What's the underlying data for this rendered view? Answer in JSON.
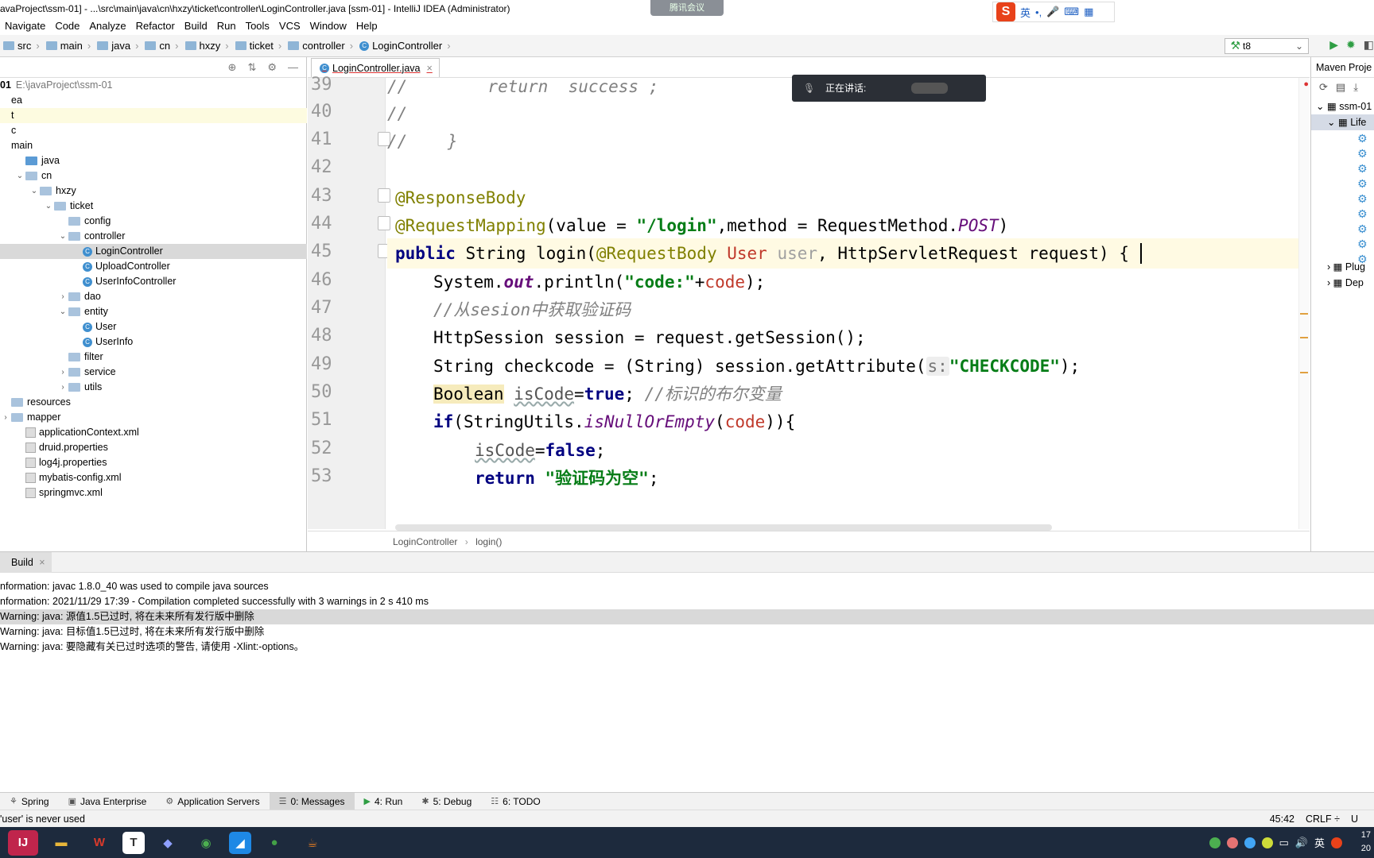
{
  "window": {
    "title": "avaProject\\ssm-01] - ...\\src\\main\\java\\cn\\hxzy\\ticket\\controller\\LoginController.java [ssm-01] - IntelliJ IDEA (Administrator)",
    "meeting_badge": "腾讯会议"
  },
  "ime": {
    "logo": "S",
    "lang": "英",
    "items": [
      "•,",
      "🎤",
      "⌨",
      "▦"
    ]
  },
  "menu": [
    "Navigate",
    "Code",
    "Analyze",
    "Refactor",
    "Build",
    "Run",
    "Tools",
    "VCS",
    "Window",
    "Help"
  ],
  "nav_breadcrumb": [
    "src",
    "main",
    "java",
    "cn",
    "hxzy",
    "ticket",
    "controller",
    "LoginController"
  ],
  "run_config": "t8",
  "project_tree": {
    "root_label": "01",
    "root_path": "E:\\javaProject\\ssm-01",
    "rows": [
      {
        "text": "ea",
        "indent": 0,
        "arrow": "",
        "icon": ""
      },
      {
        "text": "t",
        "indent": 0,
        "arrow": "",
        "icon": ""
      },
      {
        "text": "c",
        "indent": 0,
        "arrow": "",
        "icon": ""
      },
      {
        "text": "main",
        "indent": 0,
        "arrow": "",
        "icon": ""
      },
      {
        "text": "java",
        "indent": 1,
        "arrow": "",
        "icon": "src"
      },
      {
        "text": "cn",
        "indent": 1,
        "arrow": "v",
        "icon": "folder"
      },
      {
        "text": "hxzy",
        "indent": 2,
        "arrow": "v",
        "icon": "folder"
      },
      {
        "text": "ticket",
        "indent": 3,
        "arrow": "v",
        "icon": "folder"
      },
      {
        "text": "config",
        "indent": 4,
        "arrow": "",
        "icon": "folder"
      },
      {
        "text": "controller",
        "indent": 4,
        "arrow": "v",
        "icon": "folder"
      },
      {
        "text": "LoginController",
        "indent": 5,
        "arrow": "",
        "icon": "class"
      },
      {
        "text": "UploadController",
        "indent": 5,
        "arrow": "",
        "icon": "class"
      },
      {
        "text": "UserInfoController",
        "indent": 5,
        "arrow": "",
        "icon": "class"
      },
      {
        "text": "dao",
        "indent": 4,
        "arrow": ">",
        "icon": "folder"
      },
      {
        "text": "entity",
        "indent": 4,
        "arrow": "v",
        "icon": "folder"
      },
      {
        "text": "User",
        "indent": 5,
        "arrow": "",
        "icon": "class"
      },
      {
        "text": "UserInfo",
        "indent": 5,
        "arrow": "",
        "icon": "class"
      },
      {
        "text": "filter",
        "indent": 4,
        "arrow": "",
        "icon": "folder"
      },
      {
        "text": "service",
        "indent": 4,
        "arrow": ">",
        "icon": "folder"
      },
      {
        "text": "utils",
        "indent": 4,
        "arrow": ">",
        "icon": "folder"
      },
      {
        "text": "resources",
        "indent": 0,
        "arrow": "",
        "icon": "folder"
      },
      {
        "text": "mapper",
        "indent": 0,
        "arrow": ">",
        "icon": "folder"
      },
      {
        "text": "applicationContext.xml",
        "indent": 1,
        "arrow": "",
        "icon": "xml"
      },
      {
        "text": "druid.properties",
        "indent": 1,
        "arrow": "",
        "icon": "xml"
      },
      {
        "text": "log4j.properties",
        "indent": 1,
        "arrow": "",
        "icon": "xml"
      },
      {
        "text": "mybatis-config.xml",
        "indent": 1,
        "arrow": "",
        "icon": "xml"
      },
      {
        "text": "springmvc.xml",
        "indent": 1,
        "arrow": "",
        "icon": "xml"
      }
    ]
  },
  "editor": {
    "tab_label": "LoginController.java",
    "line_numbers": [
      "39",
      "40",
      "41",
      "42",
      "43",
      "44",
      "45",
      "46",
      "47",
      "48",
      "49",
      "50",
      "51",
      "52",
      "53"
    ],
    "lines": {
      "l39": "//        return  success ;",
      "l40": "//",
      "l41": "//    }",
      "l43": "@ResponseBody",
      "l44a": "@RequestMapping",
      "l44b": "(value = ",
      "l44c": "\"/login\"",
      "l44d": ",method = RequestMethod.",
      "l44e": "POST",
      "l44f": ")",
      "l45a": "public",
      "l45b": " String login(",
      "l45c": "@RequestBody",
      "l45d": " User",
      "l45e": " user",
      "l45f": ", HttpServletRequest request) {",
      "l46a": "System.",
      "l46b": "out",
      "l46c": ".println(",
      "l46d": "\"code:\"",
      "l46e": "+",
      "l46f": "code",
      "l46g": ");",
      "l47": "//从sesion中获取验证码",
      "l48": "HttpSession session = request.getSession();",
      "l49a": "String checkcode = (String) session.getAttribute(",
      "l49b": "s:",
      "l49c": "\"CHECKCODE\"",
      "l49d": ");",
      "l50a": "Boolean",
      "l50b": "isCode",
      "l50c": "=",
      "l50d": "true",
      "l50e": ";",
      "l50f": " //标识的布尔变量",
      "l51a": "if",
      "l51b": "(StringUtils.",
      "l51c": "isNullOrEmpty",
      "l51d": "(",
      "l51e": "code",
      "l51f": ")){",
      "l52a": "isCode",
      "l52b": "=",
      "l52c": "false",
      "l52d": ";",
      "l53a": "return",
      "l53b": "\"验证码为空\"",
      "l53c": ";"
    },
    "bottom_breadcrumb": [
      "LoginController",
      "login()"
    ]
  },
  "speaking": {
    "label": "正在讲话:"
  },
  "maven": {
    "title": "Maven Proje",
    "rows": [
      "ssm-01",
      "Life",
      "",
      "",
      "",
      "",
      "",
      "",
      "",
      "",
      "Plug",
      "Dep"
    ]
  },
  "build": {
    "tab_label": "Build",
    "messages": [
      "nformation: javac 1.8.0_40 was used to compile java sources",
      "nformation: 2021/11/29 17:39 - Compilation completed successfully with 3 warnings in 2 s 410 ms",
      "Warning: java: 源值1.5已过时, 将在未来所有发行版中删除",
      "Warning: java: 目标值1.5已过时, 将在未来所有发行版中删除",
      "Warning: java: 要隐藏有关已过时选项的警告, 请使用 -Xlint:-options。"
    ]
  },
  "bottom_tabs": [
    {
      "label": "Spring",
      "icon": "⚘"
    },
    {
      "label": "Java Enterprise",
      "icon": "▣"
    },
    {
      "label": "Application Servers",
      "icon": "⚙"
    },
    {
      "label": "0: Messages",
      "icon": "☰"
    },
    {
      "label": "4: Run",
      "icon": "▶"
    },
    {
      "label": "5: Debug",
      "icon": "✱"
    },
    {
      "label": "6: TODO",
      "icon": "☷"
    }
  ],
  "status": {
    "message": "'user' is never used",
    "position": "45:42",
    "line_sep": "CRLF ÷",
    "encoding": "U"
  },
  "taskbar": {
    "apps": [
      {
        "label": "IJ",
        "color": "#c0254c"
      },
      {
        "label": "▬",
        "color": "#e8b63a"
      },
      {
        "label": "W",
        "color": "#d93a2b"
      },
      {
        "label": "T",
        "color": "#333333"
      },
      {
        "label": "◆",
        "color": "#5a6fd0"
      },
      {
        "label": "◉",
        "color": "#2f9e44"
      },
      {
        "label": "◢",
        "color": "#1e88e5"
      },
      {
        "label": "●",
        "color": "#43a047"
      },
      {
        "label": "☕",
        "color": "#e07b24"
      }
    ],
    "tray_lang": "英",
    "clock_time": "17",
    "clock_date": "20"
  }
}
